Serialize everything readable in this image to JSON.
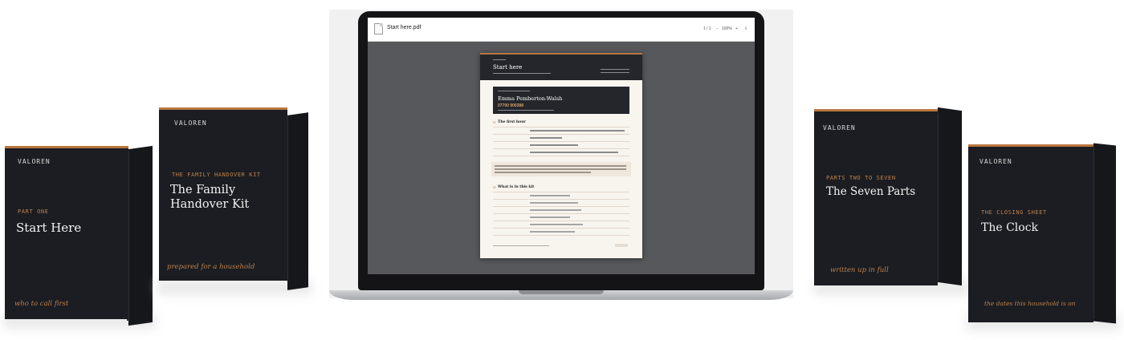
{
  "books": [
    {
      "brand": "VALOREN",
      "kicker": "PART ONE",
      "title": "Start Here",
      "tagline": "who to call first"
    },
    {
      "brand": "VALOREN",
      "kicker": "THE FAMILY HANDOVER KIT",
      "title_lines": [
        "The Family",
        "Handover Kit"
      ],
      "tagline": "prepared for a household"
    },
    {
      "brand": "VALOREN",
      "kicker": "PARTS TWO TO SEVEN",
      "title": "The Seven Parts",
      "tagline": "written up in full"
    },
    {
      "brand": "VALOREN",
      "kicker": "THE CLOSING SHEET",
      "title": "The Clock",
      "tagline": "the dates this household is on"
    }
  ],
  "viewer": {
    "filename": "Start here.pdf",
    "page_indicator": "1 / 1",
    "zoom_out": "−",
    "zoom": "100%",
    "zoom_in": "+",
    "download_icon": "download-icon"
  },
  "pdf": {
    "title": "Start here",
    "contact_name": "Emma Pemberton-Walsh",
    "contact_phone": "07700 900388",
    "section1_title": "The first hour",
    "section2_title": "What is in this kit"
  },
  "colors": {
    "book_cover": "#1b1d22",
    "accent_copper": "#b9773e",
    "viewer_background": "#57585b"
  }
}
